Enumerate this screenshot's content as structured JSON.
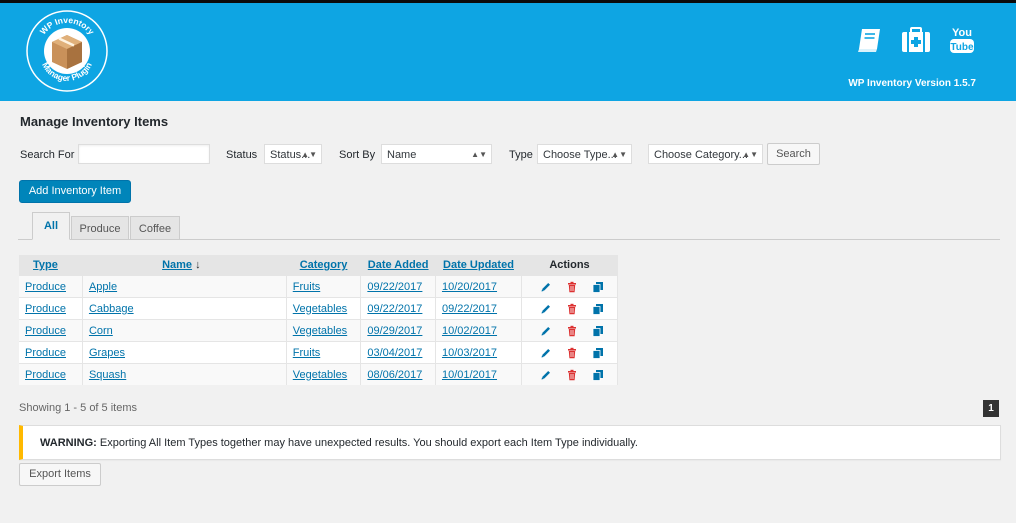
{
  "header": {
    "logo_text_top": "WP Inventory",
    "logo_text_bottom": "Manager Plugin",
    "version": "WP Inventory Version 1.5.7",
    "icons": [
      "book-icon",
      "medkit-icon",
      "youtube-icon"
    ],
    "youtube_label_top": "You",
    "youtube_label_bottom": "Tube"
  },
  "page": {
    "title": "Manage Inventory Items"
  },
  "filters": {
    "search_label": "Search For",
    "search_value": "",
    "status_label": "Status",
    "status_value": "Status...",
    "sort_label": "Sort By",
    "sort_value": "Name",
    "type_label": "Type",
    "type_value": "Choose Type...",
    "category_value": "Choose Category...",
    "search_button": "Search"
  },
  "add_button": "Add Inventory Item",
  "tabs": [
    {
      "label": "All",
      "active": true
    },
    {
      "label": "Produce",
      "active": false
    },
    {
      "label": "Coffee",
      "active": false
    }
  ],
  "table": {
    "headers": {
      "type": "Type",
      "name": "Name",
      "name_sort": "↓",
      "category": "Category",
      "date_added": "Date Added",
      "date_updated": "Date Updated",
      "actions": "Actions"
    },
    "rows": [
      {
        "type": "Produce",
        "name": "Apple",
        "category": "Fruits",
        "date_added": "09/22/2017",
        "date_updated": "10/20/2017"
      },
      {
        "type": "Produce",
        "name": "Cabbage",
        "category": "Vegetables",
        "date_added": "09/22/2017",
        "date_updated": "09/22/2017"
      },
      {
        "type": "Produce",
        "name": "Corn",
        "category": "Vegetables",
        "date_added": "09/29/2017",
        "date_updated": "10/02/2017"
      },
      {
        "type": "Produce",
        "name": "Grapes",
        "category": "Fruits",
        "date_added": "03/04/2017",
        "date_updated": "10/03/2017"
      },
      {
        "type": "Produce",
        "name": "Squash",
        "category": "Vegetables",
        "date_added": "08/06/2017",
        "date_updated": "10/01/2017"
      }
    ]
  },
  "showing_text": "Showing 1 - 5 of 5 items",
  "page_number": "1",
  "warning": {
    "label": "WARNING:",
    "text": "Exporting All Item Types together may have unexpected results. You should export each Item Type individually."
  },
  "export_button": "Export Items",
  "colors": {
    "header_bg": "#0ea5e3",
    "primary": "#0085ba",
    "link": "#0073aa",
    "warning_border": "#ffb900",
    "delete_icon": "#dc3232"
  }
}
